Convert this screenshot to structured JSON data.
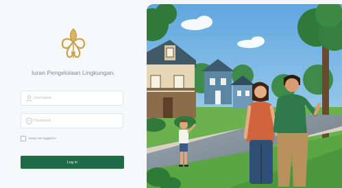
{
  "app": {
    "title": "Iuran Pengelolaan Lingkungan."
  },
  "form": {
    "username_placeholder": "Username",
    "password_placeholder": "Password",
    "remember_label": "Keep me logged in",
    "login_label": "Log in"
  },
  "colors": {
    "primary": "#1e6b45",
    "logo_gold": "#c9a24a"
  },
  "icons": {
    "username": "user-icon",
    "password": "shield-lock-icon"
  }
}
